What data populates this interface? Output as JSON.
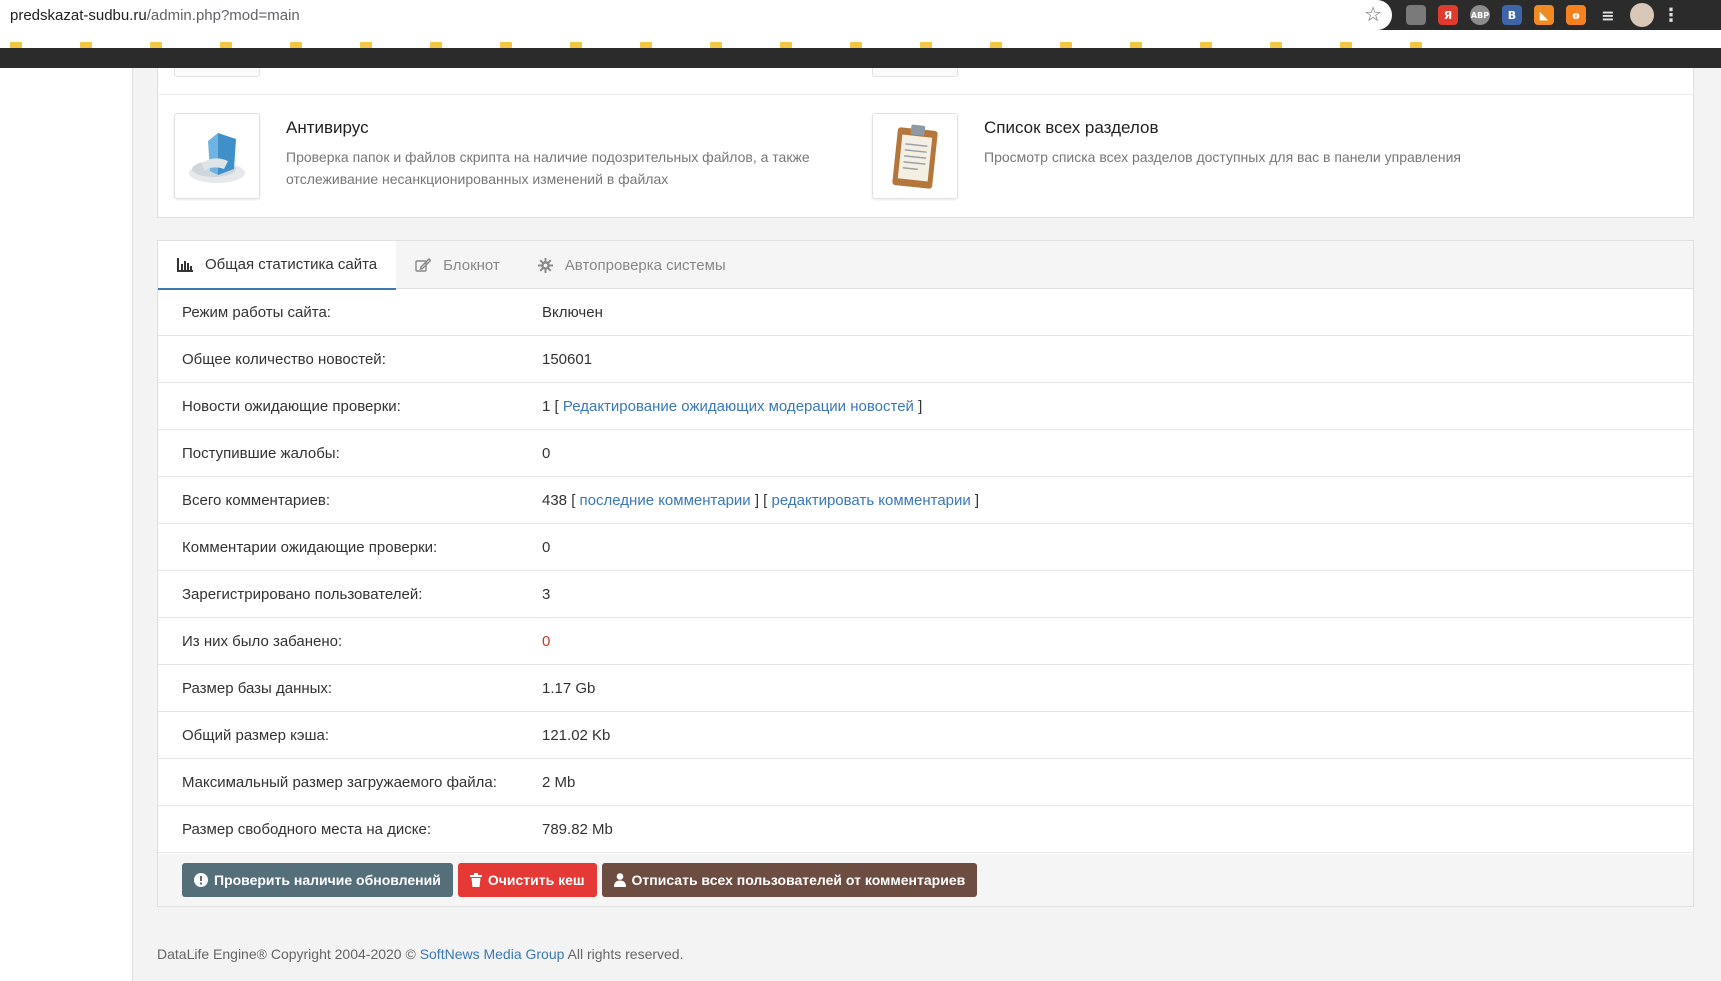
{
  "browser": {
    "url_host": "predskazat-sudbu.ru",
    "url_path": "/admin.php?mod=main",
    "extensions": [
      {
        "name": "extension-icon-grey",
        "label": "",
        "style": "grey"
      },
      {
        "name": "yandex-icon",
        "label": "Я",
        "style": "red"
      },
      {
        "name": "adblock-icon",
        "label": "ABP",
        "style": "abp"
      },
      {
        "name": "vk-icon",
        "label": "B",
        "style": "vk"
      },
      {
        "name": "rss-icon",
        "label": "◣",
        "style": "rss"
      },
      {
        "name": "odnoklassniki-icon",
        "label": "ө",
        "style": "ok"
      },
      {
        "name": "playlist-icon",
        "label": "≡",
        "style": "menu"
      },
      {
        "name": "profile-avatar",
        "label": "",
        "style": "avatar"
      },
      {
        "name": "browser-menu-icon",
        "label": "⋮",
        "style": "more"
      }
    ]
  },
  "quick_links": [
    {
      "title": "Антивирус",
      "description_line1": "Проверка папок и файлов скрипта на наличие подозрительных файлов, а также",
      "description_line2": "отслеживание несанкционированных изменений в файлах",
      "icon": "antivirus-icon"
    },
    {
      "title": "Список всех разделов",
      "description_line1": "Просмотр списка всех разделов доступных для вас в панели управления",
      "description_line2": "",
      "icon": "clipboard-icon"
    }
  ],
  "tabs": [
    {
      "label": "Общая статистика сайта",
      "icon": "bar-chart-icon",
      "active": true
    },
    {
      "label": "Блокнот",
      "icon": "edit-icon",
      "active": false
    },
    {
      "label": "Автопроверка системы",
      "icon": "gear-icon",
      "active": false
    }
  ],
  "stats": {
    "site_mode": {
      "label": "Режим работы сайта:",
      "value": "Включен"
    },
    "news_total": {
      "label": "Общее количество новостей:",
      "value": "150601"
    },
    "news_pending": {
      "label": "Новости ожидающие проверки:",
      "value": "1",
      "link": "Редактирование ожидающих модерации новостей"
    },
    "complaints": {
      "label": "Поступившие жалобы:",
      "value": "0"
    },
    "comments_total": {
      "label": "Всего комментариев:",
      "value": "438",
      "link1": "последние комментарии",
      "link2": "редактировать комментарии"
    },
    "comments_pending": {
      "label": "Комментарии ожидающие проверки:",
      "value": "0"
    },
    "users_registered": {
      "label": "Зарегистрировано пользователей:",
      "value": "3"
    },
    "users_banned": {
      "label": "Из них было забанено:",
      "value": "0"
    },
    "db_size": {
      "label": "Размер базы данных:",
      "value": "1.17 Gb"
    },
    "cache_size": {
      "label": "Общий размер кэша:",
      "value": "121.02 Kb"
    },
    "max_upload": {
      "label": "Максимальный размер загружаемого файла:",
      "value": "2 Mb"
    },
    "disk_free": {
      "label": "Размер свободного места на диске:",
      "value": "789.82 Mb"
    }
  },
  "actions": {
    "check_updates": "Проверить наличие обновлений",
    "clear_cache": "Очистить кеш",
    "unsubscribe_all": "Отписать всех пользователей от комментариев"
  },
  "footer": {
    "prefix": "DataLife Engine® Copyright 2004-2020 ©",
    "link": "SoftNews Media Group",
    "suffix": "All rights reserved."
  },
  "colors": {
    "accent_link": "#3a78b8",
    "danger_value": "#c0392b",
    "btn_slate": "#546e7a",
    "btn_red": "#e53935",
    "btn_brown": "#6d4c41"
  }
}
